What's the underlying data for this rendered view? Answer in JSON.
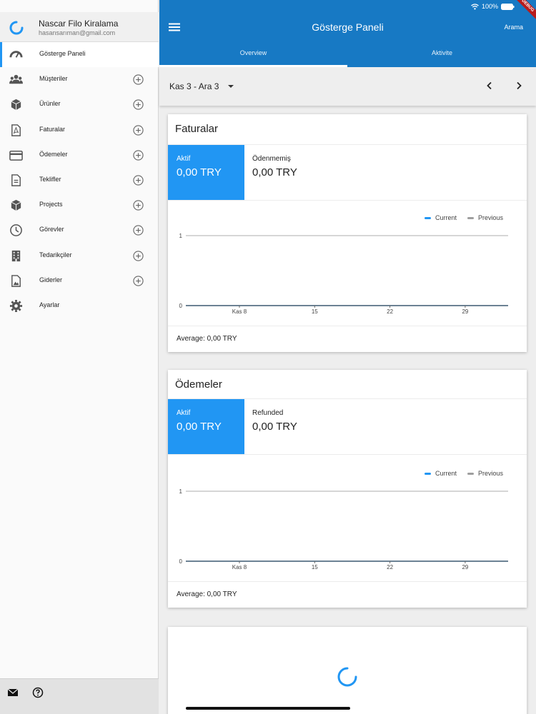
{
  "status": {
    "battery": "100%"
  },
  "debug_banner": "DEBUG",
  "sidebar": {
    "company": "Nascar Filo Kiralama",
    "email": "hasansarıman@gmail.com",
    "items": [
      {
        "label": "Gösterge Paneli",
        "icon": "dashboard-icon",
        "add": false,
        "active": true
      },
      {
        "label": "Müşteriler",
        "icon": "people-icon",
        "add": true
      },
      {
        "label": "Ürünler",
        "icon": "cube-icon",
        "add": true
      },
      {
        "label": "Faturalar",
        "icon": "pdf-icon",
        "add": true
      },
      {
        "label": "Ödemeler",
        "icon": "credit-card-icon",
        "add": true
      },
      {
        "label": "Teklifler",
        "icon": "document-icon",
        "add": true
      },
      {
        "label": "Projects",
        "icon": "cube-icon",
        "add": true
      },
      {
        "label": "Görevler",
        "icon": "clock-icon",
        "add": true
      },
      {
        "label": "Tedarikçiler",
        "icon": "building-icon",
        "add": true
      },
      {
        "label": "Giderler",
        "icon": "image-file-icon",
        "add": true
      },
      {
        "label": "Ayarlar",
        "icon": "gear-icon",
        "add": false
      }
    ],
    "footer_icons": [
      "mail-icon",
      "help-icon"
    ]
  },
  "appbar": {
    "title": "Gösterge Paneli",
    "search": "Arama",
    "tabs": [
      "Overview",
      "Aktivite"
    ],
    "active_tab": "Overview"
  },
  "date_range": "Kas 3 - Ara 3",
  "colors": {
    "primary": "#1779c4",
    "accent": "#2196f3",
    "previous": "#9e9e9e"
  },
  "invoices": {
    "title": "Faturalar",
    "active_label": "Aktif",
    "active_value": "0,00 TRY",
    "other_label": "Ödenmemiş",
    "other_value": "0,00 TRY",
    "average": "Average: 0,00 TRY"
  },
  "payments": {
    "title": "Ödemeler",
    "active_label": "Aktif",
    "active_value": "0,00 TRY",
    "other_label": "Refunded",
    "other_value": "0,00 TRY",
    "average": "Average: 0,00 TRY"
  },
  "chart_data": [
    {
      "type": "line",
      "x": [
        "Kas 8",
        "15",
        "22",
        "29"
      ],
      "series": [
        {
          "name": "Current",
          "values": [
            0,
            0,
            0,
            0
          ]
        },
        {
          "name": "Previous",
          "values": [
            0,
            0,
            0,
            0
          ]
        }
      ],
      "yticks": [
        "1",
        "0"
      ],
      "ylim": [
        0,
        1
      ],
      "grid": true,
      "legend": "top-right"
    },
    {
      "type": "line",
      "x": [
        "Kas 8",
        "15",
        "22",
        "29"
      ],
      "series": [
        {
          "name": "Current",
          "values": [
            0,
            0,
            0,
            0
          ]
        },
        {
          "name": "Previous",
          "values": [
            0,
            0,
            0,
            0
          ]
        }
      ],
      "yticks": [
        "1",
        "0"
      ],
      "ylim": [
        0,
        1
      ],
      "grid": true,
      "legend": "top-right"
    }
  ]
}
